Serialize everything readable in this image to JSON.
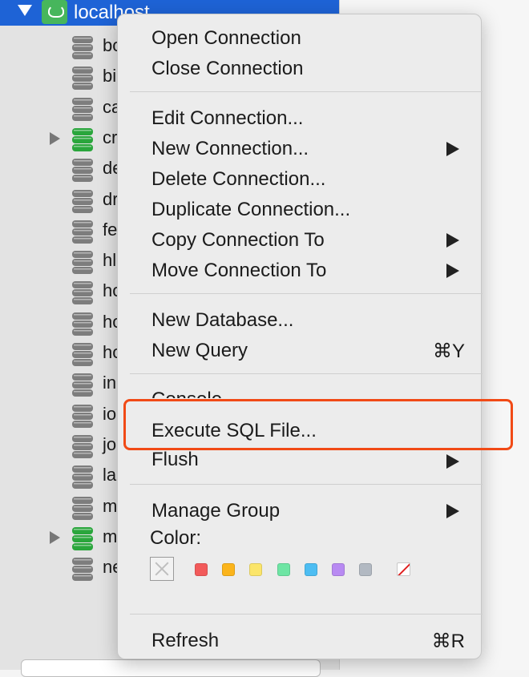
{
  "sidebar": {
    "root": {
      "label": "localhost",
      "icon": "mysql-server-icon"
    },
    "items": [
      {
        "label": "bo",
        "icon": "database-icon",
        "expandable": false,
        "color": "gray"
      },
      {
        "label": "bi",
        "icon": "database-icon",
        "expandable": false,
        "color": "gray"
      },
      {
        "label": "ca",
        "icon": "database-icon",
        "expandable": false,
        "color": "gray"
      },
      {
        "label": "cr",
        "icon": "database-icon",
        "expandable": true,
        "color": "green"
      },
      {
        "label": "de",
        "icon": "database-icon",
        "expandable": false,
        "color": "gray"
      },
      {
        "label": "dr",
        "icon": "database-icon",
        "expandable": false,
        "color": "gray"
      },
      {
        "label": "fe",
        "icon": "database-icon",
        "expandable": false,
        "color": "gray"
      },
      {
        "label": "hl",
        "icon": "database-icon",
        "expandable": false,
        "color": "gray"
      },
      {
        "label": "ho",
        "icon": "database-icon",
        "expandable": false,
        "color": "gray"
      },
      {
        "label": "ho",
        "icon": "database-icon",
        "expandable": false,
        "color": "gray"
      },
      {
        "label": "ho",
        "icon": "database-icon",
        "expandable": false,
        "color": "gray"
      },
      {
        "label": "in",
        "icon": "database-icon",
        "expandable": false,
        "color": "gray"
      },
      {
        "label": "io",
        "icon": "database-icon",
        "expandable": false,
        "color": "gray"
      },
      {
        "label": "jo",
        "icon": "database-icon",
        "expandable": false,
        "color": "gray"
      },
      {
        "label": "la",
        "icon": "database-icon",
        "expandable": false,
        "color": "gray"
      },
      {
        "label": "m",
        "icon": "database-icon",
        "expandable": false,
        "color": "gray"
      },
      {
        "label": "m",
        "icon": "database-icon",
        "expandable": true,
        "color": "green"
      },
      {
        "label": "ne",
        "icon": "database-icon",
        "expandable": false,
        "color": "gray"
      }
    ]
  },
  "menu": {
    "open_connection": "Open Connection",
    "close_connection": "Close Connection",
    "edit_connection": "Edit Connection...",
    "new_connection": "New Connection...",
    "delete_connection": "Delete Connection...",
    "duplicate_connection": "Duplicate Connection...",
    "copy_connection_to": "Copy Connection To",
    "move_connection_to": "Move Connection To",
    "new_database": "New Database...",
    "new_query": "New Query",
    "new_query_shortcut": "⌘Y",
    "console": "Console",
    "execute_sql_file": "Execute SQL File...",
    "flush": "Flush",
    "manage_group": "Manage Group",
    "color_label": "Color:",
    "refresh": "Refresh",
    "refresh_shortcut": "⌘R"
  },
  "colors": {
    "selection": "#1e63d6",
    "highlight_box": "#f14a16",
    "swatches": [
      "#f25a5a",
      "#fbb41b",
      "#fbe56a",
      "#6ee5a4",
      "#4dbdf2",
      "#b88af2",
      "#b2b9c2"
    ]
  }
}
